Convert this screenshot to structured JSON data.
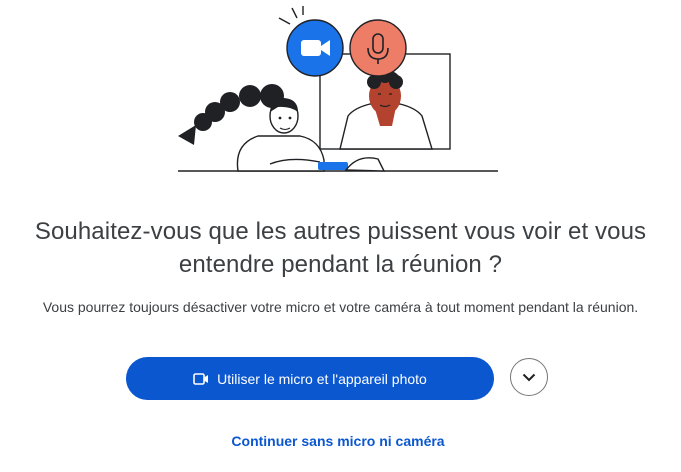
{
  "dialog": {
    "headline_line1": "Souhaitez-vous que les autres puissent vous voir et vous",
    "headline_line2": "entendre pendant la réunion ?",
    "subtext": "Vous pourrez toujours désactiver votre micro et votre caméra à tout moment pendant la réunion.",
    "primary_button_label": "Utiliser le micro et l'appareil photo",
    "secondary_link": "Continuer sans micro ni caméra",
    "icons": {
      "primary_button_icon": "video-camera-icon",
      "more_options_icon": "chevron-down-icon",
      "illustration_camera_icon": "video-camera-icon",
      "illustration_mic_icon": "microphone-icon"
    }
  },
  "colors": {
    "accent": "#0b57d0",
    "camera_bubble": "#1a73e8",
    "mic_bubble": "#ee7d67",
    "text": "#3c4043"
  }
}
